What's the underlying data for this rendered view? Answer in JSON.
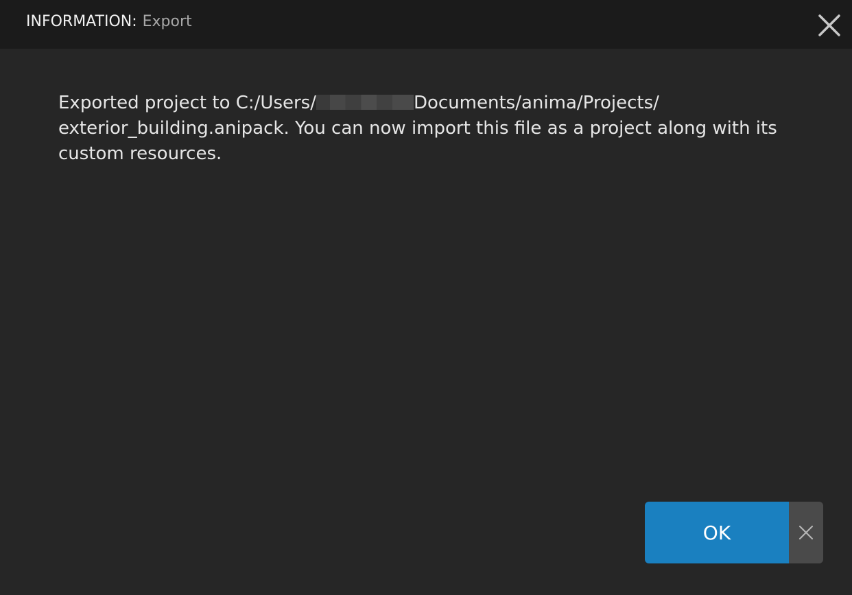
{
  "dialog": {
    "title_label": "INFORMATION:",
    "title_sub": "Export",
    "close_icon": "close-icon"
  },
  "message": {
    "line1_prefix": "Exported project to C:/Users/",
    "line1_suffix": "Documents/anima/Projects/",
    "line2": "exterior_building.anipack. You can now import this file as a project along with its",
    "line3": "custom resources."
  },
  "buttons": {
    "ok_label": "OK",
    "dismiss_icon": "close-icon"
  },
  "colors": {
    "titlebar_bg": "#1b1b1b",
    "body_bg": "#262626",
    "ok_bg": "#1a80c0",
    "dismiss_bg": "#4a4a4a"
  }
}
